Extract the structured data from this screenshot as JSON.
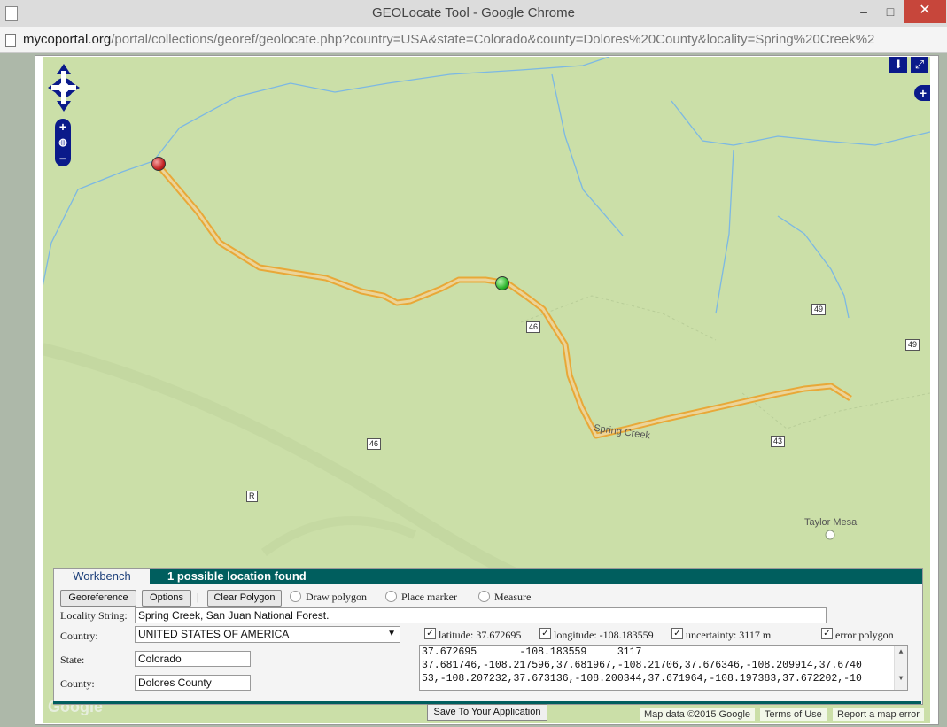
{
  "window": {
    "title": "GEOLocate Tool - Google Chrome",
    "minimize": "‒",
    "maximize": "□",
    "close": "✕"
  },
  "address": {
    "domain": "mycoportal.org",
    "path": "/portal/collections/georef/geolocate.php?country=USA&state=Colorado&county=Dolores%20County&locality=Spring%20Creek%2"
  },
  "map": {
    "road_labels": [
      "46",
      "46",
      "49",
      "49",
      "43",
      "R"
    ],
    "creek_label": "Spring Creek",
    "place_label": "Taylor Mesa",
    "google_logo": "Google",
    "footer": {
      "map_data": "Map data ©2015 Google",
      "terms": "Terms of Use",
      "report": "Report a map error"
    },
    "controls": {
      "zoom_in": "+",
      "zoom_out": "−",
      "top_download": "⬇",
      "top_expand": "⤢",
      "side_plus": "+"
    },
    "colors": {
      "land": "#cbdfa8",
      "water": "#7cb8e3",
      "route": "#e8a838",
      "control": "#0a1a8a"
    }
  },
  "workbench": {
    "tab": "Workbench",
    "status": "1 possible location found",
    "buttons": {
      "georeference": "Georeference",
      "options": "Options",
      "separator": "|",
      "clear_polygon": "Clear Polygon"
    },
    "radios": {
      "draw_polygon": "Draw polygon",
      "place_marker": "Place marker",
      "measure": "Measure"
    },
    "labels": {
      "locality": "Locality String:",
      "country": "Country:",
      "state": "State:",
      "county": "County:"
    },
    "values": {
      "locality": "Spring Creek, San Juan National Forest.",
      "country": "UNITED STATES OF AMERICA",
      "state": "Colorado",
      "county": "Dolores County"
    },
    "checks": {
      "latitude": "latitude: 37.672695",
      "longitude": "longitude: -108.183559",
      "uncertainty": "uncertainty: 3117 m",
      "error_polygon": "error polygon"
    },
    "output_lines": [
      "37.672695       -108.183559     3117",
      "37.681746,-108.217596,37.681967,-108.21706,37.676346,-108.209914,37.6740",
      "53,-108.207232,37.673136,-108.200344,37.671964,-108.197383,37.672202,-10"
    ],
    "save": "Save To Your Application"
  }
}
